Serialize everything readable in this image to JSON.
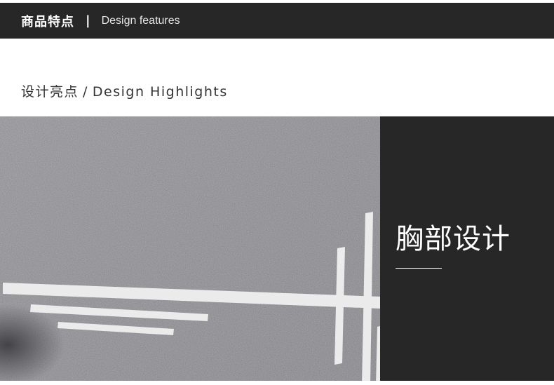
{
  "header": {
    "title_cn": "商品特点",
    "divider": "|",
    "title_en": "Design features"
  },
  "section": {
    "title_cn": "设计亮点",
    "separator": "/",
    "title_en": "Design Highlights"
  },
  "feature": {
    "title": "胸部设计"
  },
  "colors": {
    "dark_bar": "#272727",
    "fabric_gray": "#6f6f73",
    "stripe_white": "#f2f2f2",
    "text_dark": "#333333"
  }
}
